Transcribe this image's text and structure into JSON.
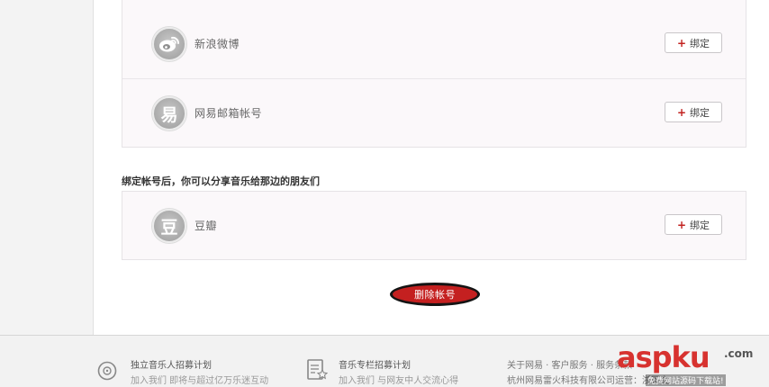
{
  "accounts": {
    "rows": [
      {
        "name": "新浪微博",
        "icon": "weibo-icon",
        "button": "绑定"
      },
      {
        "name": "网易邮箱帐号",
        "icon": "netease-mail-icon",
        "badge_char": "易",
        "button": "绑定"
      }
    ],
    "share_section_title": "绑定帐号后，你可以分享音乐给那边的朋友们",
    "share_rows": [
      {
        "name": "豆瓣",
        "icon": "douban-icon",
        "badge_char": "豆",
        "button": "绑定"
      }
    ],
    "delete_label": "删除帐号"
  },
  "footer": {
    "item1": {
      "title": "独立音乐人招募计划",
      "desc": "加入我们 即将与超过亿万乐迷互动",
      "icon": "disc-icon"
    },
    "item2": {
      "title": "音乐专栏招募计划",
      "desc": "加入我们 与网友中人交流心得",
      "icon": "article-star-icon"
    },
    "links": "关于网易 · 客户服务 · 服务条款",
    "company": "杭州网易雷火科技有限公司运营：浙网文"
  },
  "watermark": {
    "text": "aspku",
    "suffix": ".com",
    "sub": "免费网站源码下载站!"
  },
  "colors": {
    "accent_red": "#c42020",
    "plus_red": "#c2221f"
  }
}
